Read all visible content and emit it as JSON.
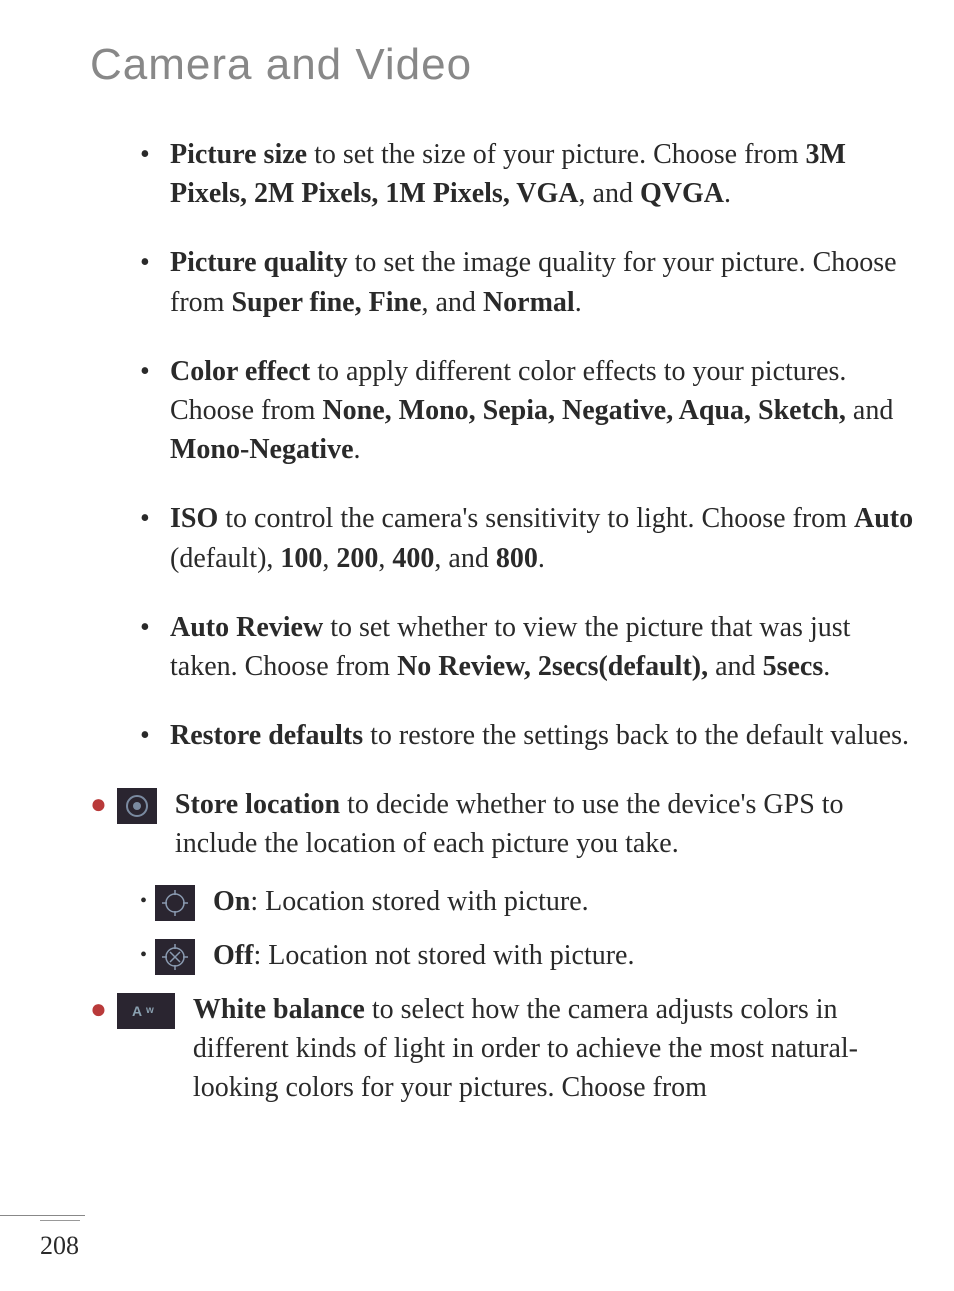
{
  "title": "Camera and Video",
  "bullets": {
    "pictureSize": {
      "term": "Picture size",
      "text1": " to set the size of your picture. Choose from ",
      "options": "3M Pixels, 2M Pixels, 1M Pixels, VGA",
      "text2": ", and ",
      "last": "QVGA",
      "text3": "."
    },
    "pictureQuality": {
      "term": "Picture quality",
      "text1": " to set the image quality for your picture. Choose from ",
      "options": "Super fine, Fine",
      "text2": ", and ",
      "last": "Normal",
      "text3": "."
    },
    "colorEffect": {
      "term": "Color effect",
      "text1": " to apply different color effects to your pictures. Choose from ",
      "options": "None, Mono, Sepia, Negative, Aqua, Sketch,",
      "text2": " and ",
      "last": "Mono-Negative",
      "text3": "."
    },
    "iso": {
      "term": "ISO",
      "text1": " to control the camera's sensitivity to light. Choose from ",
      "opt1": "Auto",
      "text2": " (default), ",
      "opt2": "100",
      "sep1": ", ",
      "opt3": "200",
      "sep2": ", ",
      "opt4": "400",
      "text3": ", and ",
      "opt5": "800",
      "text4": "."
    },
    "autoReview": {
      "term": "Auto Review",
      "text1": " to set whether to view the picture that was just taken. Choose from ",
      "options": "No Review, 2secs(default),",
      "text2": " and ",
      "last": "5secs",
      "text3": "."
    },
    "restoreDefaults": {
      "term": "Restore defaults",
      "text1": " to restore the settings back to the default values."
    }
  },
  "iconBullets": {
    "storeLocation": {
      "term": "Store location",
      "text": " to decide whether to use the device's GPS to include the location of each picture you take."
    },
    "on": {
      "term": "On",
      "text": ": Location stored with picture."
    },
    "off": {
      "term": "Off",
      "text": ": Location not stored with picture."
    },
    "whiteBalance": {
      "term": "White balance",
      "text": " to select how the camera adjusts colors in different kinds of light in order to achieve the most natural-looking colors for your pictures. Choose from"
    }
  },
  "pageNumber": "208"
}
